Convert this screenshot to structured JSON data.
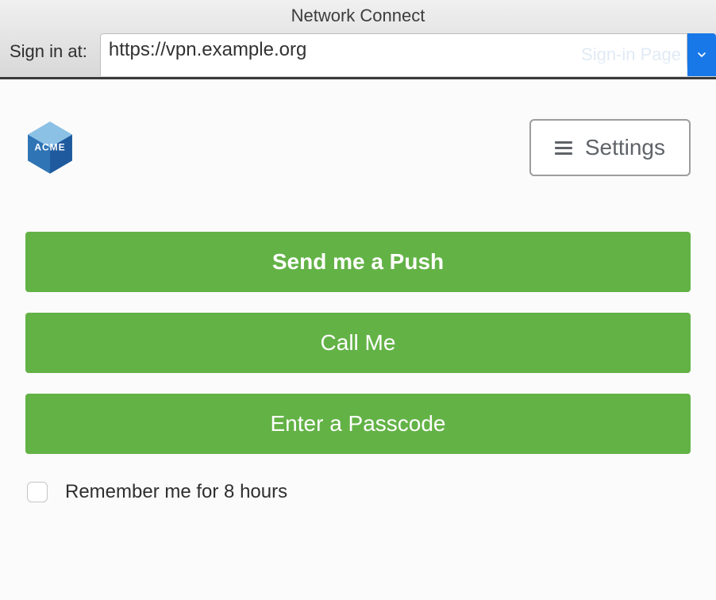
{
  "header": {
    "title": "Network Connect",
    "signin_label": "Sign in at:",
    "url_value": "https://vpn.example.org",
    "ghost_text": "Sign-in Page"
  },
  "panel": {
    "logo_text": "ACME",
    "settings_label": "Settings",
    "actions": {
      "push": "Send me a Push",
      "call": "Call Me",
      "passcode": "Enter a Passcode"
    },
    "remember_label": "Remember me for 8 hours"
  }
}
